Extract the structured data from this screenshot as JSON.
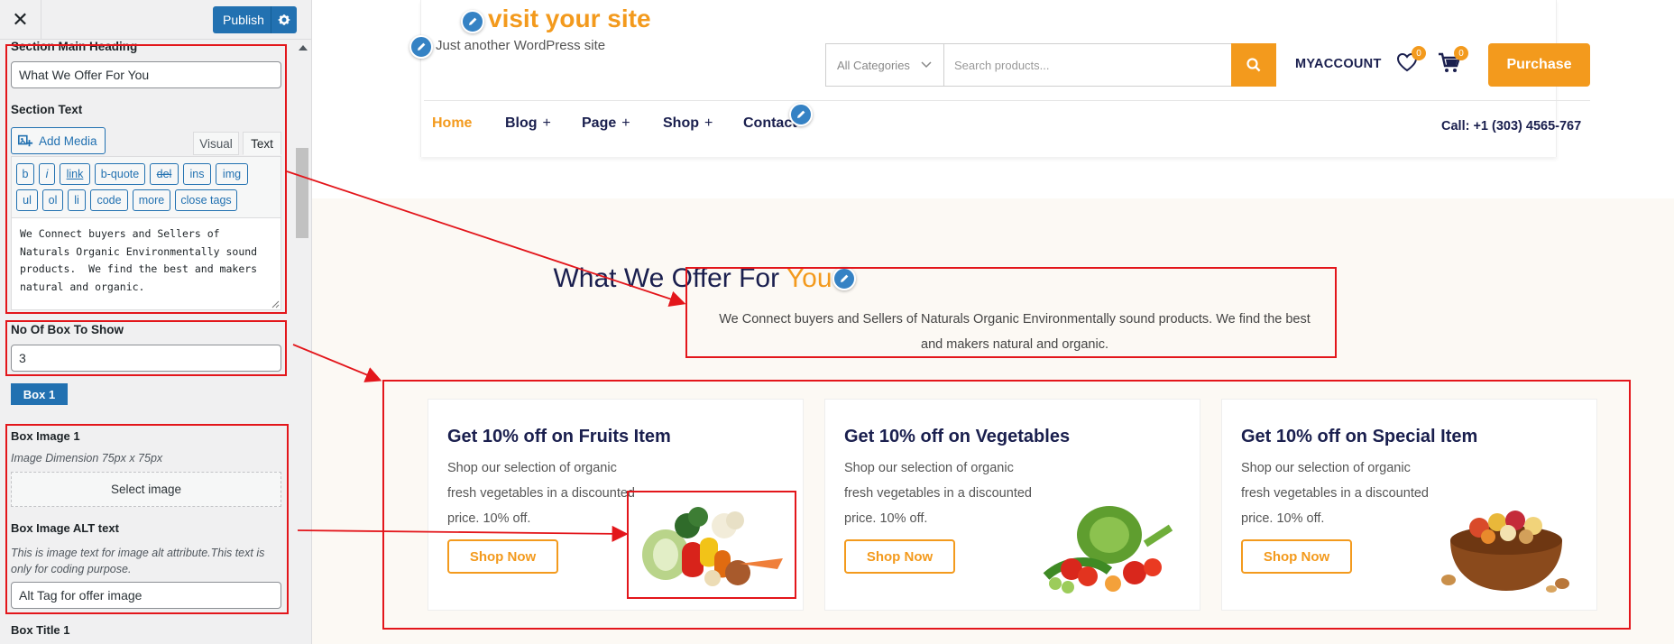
{
  "customizer": {
    "close_label": "✕",
    "publish_label": "Publish",
    "section_main_heading_label": "Section Main Heading",
    "section_main_heading_value": "What We Offer For You",
    "section_text_label": "Section Text",
    "add_media_label": "Add Media",
    "tab_visual": "Visual",
    "tab_text": "Text",
    "quicktags": [
      "b",
      "i",
      "link",
      "b-quote",
      "del",
      "ins",
      "img",
      "ul",
      "ol",
      "li",
      "code",
      "more",
      "close tags"
    ],
    "section_text_value": "We Connect buyers and Sellers of Naturals Organic Environmentally sound products.  We find the best and makers natural and organic.",
    "no_of_box_label": "No Of Box To Show",
    "no_of_box_value": "3",
    "box_button_label": "Box 1",
    "box_image_label": "Box Image 1",
    "box_image_help": "Image Dimension 75px x 75px",
    "select_image_label": "Select image",
    "box_alt_label": "Box Image ALT text",
    "box_alt_help": "This is image text for image alt attribute.This text is only for coding purpose.",
    "box_alt_value": "Alt Tag for offer image",
    "box_title_label": "Box Title 1"
  },
  "site": {
    "title": "visit your site",
    "tagline": "Just another WordPress site",
    "category_select": "All Categories",
    "search_placeholder": "Search products...",
    "myaccount": "MYACCOUNT",
    "wishlist_count": "0",
    "cart_count": "0",
    "purchase_label": "Purchase",
    "nav": [
      {
        "label": "Home",
        "plus": ""
      },
      {
        "label": "Blog",
        "plus": "+"
      },
      {
        "label": "Page",
        "plus": "+"
      },
      {
        "label": "Shop",
        "plus": "+"
      },
      {
        "label": "Contact",
        "plus": ""
      }
    ],
    "call": "Call: +1 (303) 4565-767"
  },
  "offer": {
    "title_main": "What We Offer For",
    "title_accent": "You",
    "text": "We Connect buyers and Sellers of Naturals Organic Environmentally sound products. We find the best and makers natural and organic.",
    "cards": [
      {
        "title": "Get 10% off on Fruits Item",
        "desc": "Shop our selection of organic fresh vegetables in a discounted price. 10% off.",
        "button": "Shop Now"
      },
      {
        "title": "Get 10% off on Vegetables",
        "desc": "Shop our selection of organic fresh vegetables in a discounted price. 10% off.",
        "button": "Shop Now"
      },
      {
        "title": "Get 10% off on Special Item",
        "desc": "Shop our selection of organic fresh vegetables in a discounted price. 10% off.",
        "button": "Shop Now"
      }
    ]
  },
  "colors": {
    "accent": "#f39a1d",
    "navy": "#1a1f4e",
    "wp_blue": "#2271b1",
    "annotation_red": "#e3161b"
  }
}
